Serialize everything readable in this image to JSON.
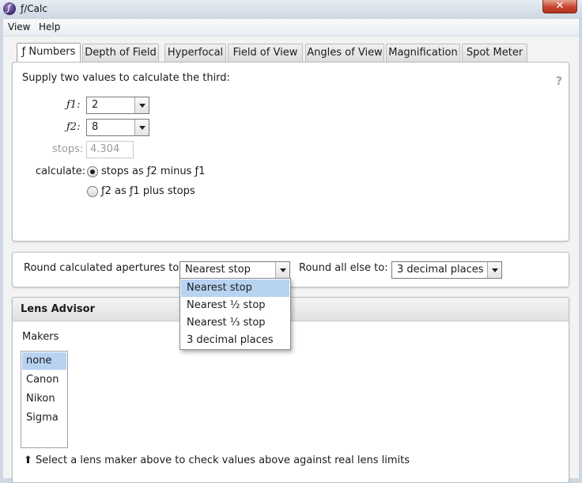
{
  "window": {
    "title": "ƒ/Calc",
    "app_glyph": "ƒ",
    "close_glyph": "✕"
  },
  "menu": {
    "items": [
      "View",
      "Help"
    ]
  },
  "tabs": [
    "ƒ Numbers",
    "Depth of Field",
    "Hyperfocal",
    "Field of View",
    "Angles of View",
    "Magnification",
    "Spot Meter"
  ],
  "numbers_panel": {
    "instruction": "Supply two values to calculate the third:",
    "help_glyph": "?",
    "f1_label": "ƒ1:",
    "f1_value": "2",
    "f2_label": "ƒ2:",
    "f2_value": "8",
    "stops_label": "stops:",
    "stops_value": "4.304",
    "calculate_label": "calculate:",
    "option1": "stops as ƒ2 minus ƒ1",
    "option2": "ƒ2 as ƒ1 plus stops"
  },
  "rounding": {
    "apertures_label": "Round calculated apertures to:",
    "apertures_value": "Nearest stop",
    "else_label": "Round all else to:",
    "else_value": "3 decimal places",
    "dropdown_options": [
      "Nearest stop",
      "Nearest ½ stop",
      "Nearest ⅓ stop",
      "3 decimal places"
    ]
  },
  "lens_advisor": {
    "title": "Lens Advisor",
    "makers_label": "Makers",
    "makers": [
      "none",
      "Canon",
      "Nikon",
      "Sigma"
    ],
    "hint": "⬆ Select a lens maker above to check values above against real lens limits"
  },
  "colors": {
    "selection": "#b8d3f2",
    "close_button": "#c7452f"
  }
}
